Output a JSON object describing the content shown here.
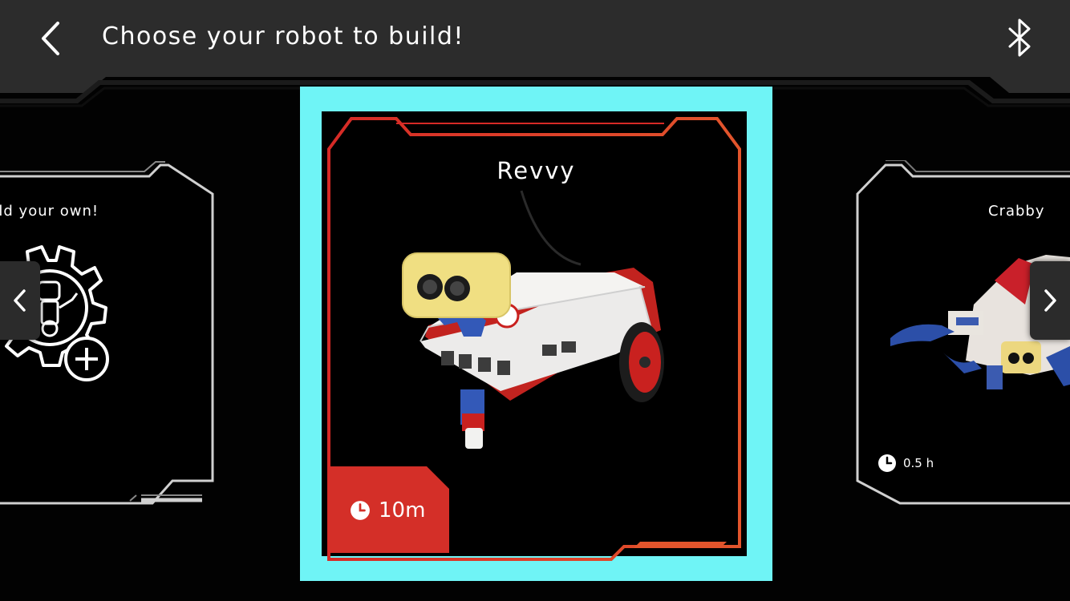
{
  "header": {
    "title": "Choose your robot to build!",
    "back_icon": "chevron-left-icon",
    "bluetooth_icon": "bluetooth-icon"
  },
  "carousel": {
    "prev_icon": "chevron-left-icon",
    "next_icon": "chevron-right-icon",
    "cards": [
      {
        "label": "Build your own!",
        "visible_label": "uild your own!",
        "icon": "gear-robot-plus-icon"
      },
      {
        "label": "Revvy",
        "time": "10m",
        "selected": true,
        "image": "revvy-robot-image"
      },
      {
        "label": "Crabby",
        "time": "0.5 h",
        "image": "crabby-robot-image"
      }
    ]
  },
  "colors": {
    "selection_highlight": "#6ff4f6",
    "accent_red": "#d9302a",
    "frame_grey": "#c9c9c9",
    "header_bg": "#2c2c2c"
  }
}
